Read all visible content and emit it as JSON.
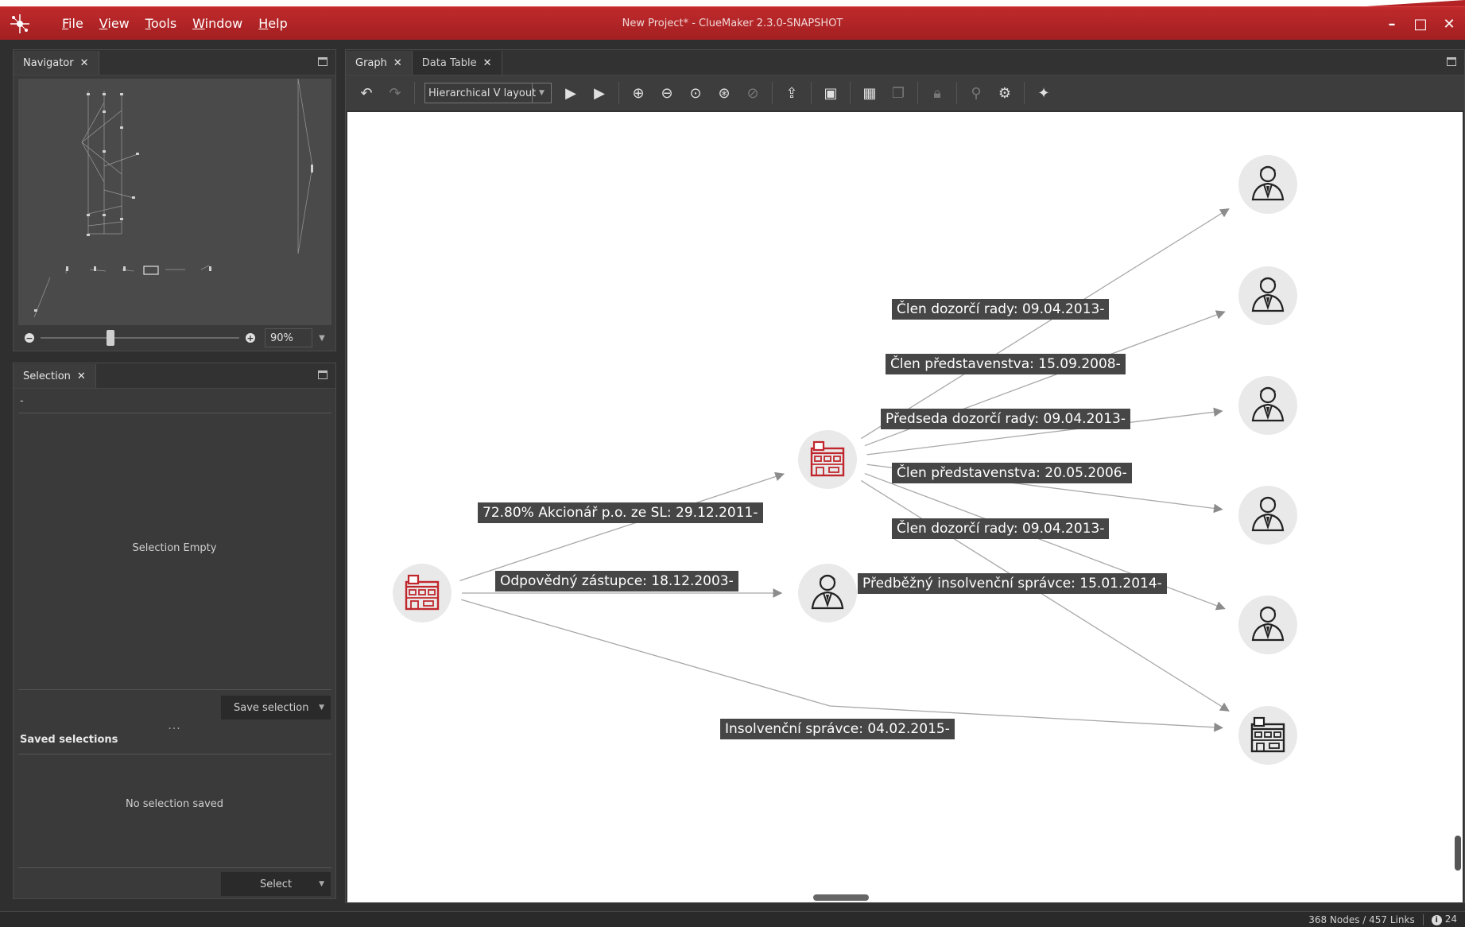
{
  "window": {
    "title": "New Project* - ClueMaker 2.3.0-SNAPSHOT",
    "minimize": "–",
    "maximize": "□",
    "close": "✕"
  },
  "menu": [
    {
      "underline": "F",
      "rest": "ile"
    },
    {
      "underline": "V",
      "rest": "iew"
    },
    {
      "underline": "T",
      "rest": "ools"
    },
    {
      "underline": "W",
      "rest": "indow"
    },
    {
      "underline": "H",
      "rest": "elp"
    }
  ],
  "navigator": {
    "tab_label": "Navigator",
    "zoom_value": "90%",
    "zoom_level_fraction": 0.35
  },
  "selection": {
    "tab_label": "Selection",
    "dash": "-",
    "empty_text": "Selection Empty",
    "save_button": "Save selection",
    "ellipsis": "...",
    "saved_title": "Saved selections",
    "no_saved_text": "No selection saved",
    "select_button": "Select"
  },
  "graph_tabs": [
    {
      "label": "Graph"
    },
    {
      "label": "Data Table"
    }
  ],
  "toolbar": {
    "layout_value": "Hierarchical V layout"
  },
  "graph": {
    "nodes": [
      {
        "id": "company-root",
        "kind": "company",
        "color": "#c0272d"
      },
      {
        "id": "company-mid",
        "kind": "company",
        "color": "#c0272d"
      },
      {
        "id": "person-mid",
        "kind": "person",
        "color": "#222222"
      },
      {
        "id": "person-1",
        "kind": "person",
        "color": "#222222"
      },
      {
        "id": "person-2",
        "kind": "person",
        "color": "#222222"
      },
      {
        "id": "person-3",
        "kind": "person",
        "color": "#222222"
      },
      {
        "id": "person-4",
        "kind": "person",
        "color": "#222222"
      },
      {
        "id": "person-5",
        "kind": "person",
        "color": "#222222"
      },
      {
        "id": "company-right",
        "kind": "company",
        "color": "#222222"
      }
    ],
    "edges": [
      {
        "from": "company-root",
        "to": "company-mid",
        "label": "72.80% Akcionář p.o. ze SL: 29.12.2011-"
      },
      {
        "from": "company-root",
        "to": "person-mid",
        "label": "Odpovědný zástupce: 18.12.2003-"
      },
      {
        "from": "company-root",
        "to": "company-right",
        "label": "Insolvenční správce: 04.02.2015-"
      },
      {
        "from": "company-mid",
        "to": "person-1",
        "label": "Člen dozorčí rady: 09.04.2013-"
      },
      {
        "from": "company-mid",
        "to": "person-2",
        "label": "Člen představenstva: 15.09.2008-"
      },
      {
        "from": "company-mid",
        "to": "person-3",
        "label": "Předseda dozorčí rady: 09.04.2013-"
      },
      {
        "from": "company-mid",
        "to": "person-4",
        "label": "Člen představenstva: 20.05.2006-"
      },
      {
        "from": "company-mid",
        "to": "person-5",
        "label": "Člen dozorčí rady: 09.04.2013-"
      },
      {
        "from": "company-mid",
        "to": "company-right",
        "label": "Předběžný insolvenční správce: 15.01.2014-"
      }
    ]
  },
  "status": {
    "counts": "368 Nodes / 457 Links",
    "info_icon": "i",
    "info_count": "24"
  },
  "colors": {
    "titlebar": "#b32224",
    "accent_red": "#c0272d",
    "label_bg": "#464646"
  }
}
